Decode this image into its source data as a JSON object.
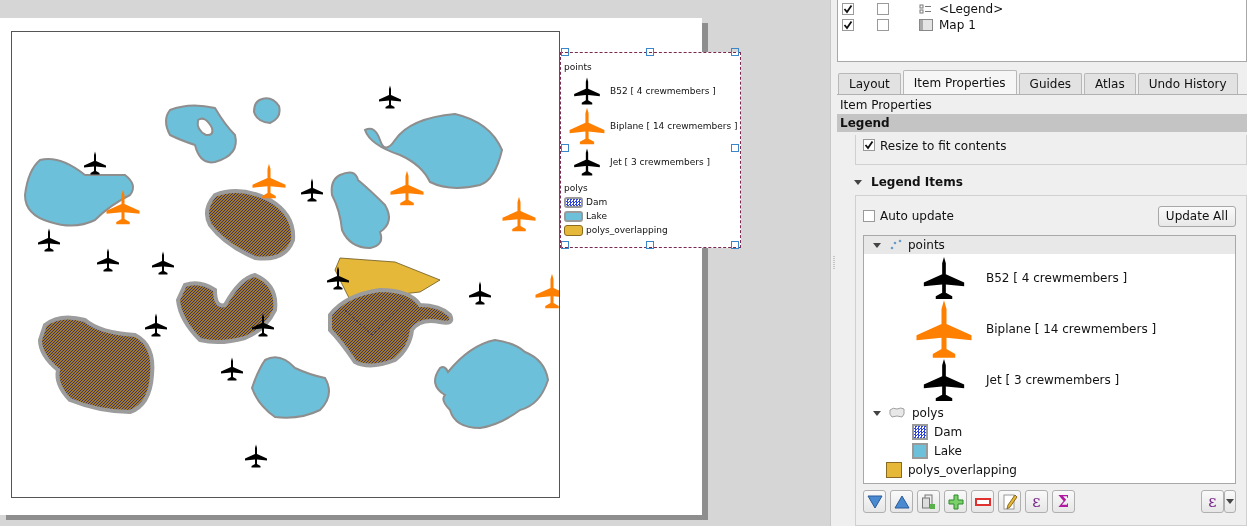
{
  "layout_items": [
    {
      "label": "<Legend>",
      "visible": true,
      "locked": false,
      "kind": "legend"
    },
    {
      "label": "Map 1",
      "visible": true,
      "locked": false,
      "kind": "map"
    }
  ],
  "tabs": [
    {
      "label": "Layout",
      "selected": false
    },
    {
      "label": "Item Properties",
      "selected": true
    },
    {
      "label": "Guides",
      "selected": false
    },
    {
      "label": "Atlas",
      "selected": false
    },
    {
      "label": "Undo History",
      "selected": false
    }
  ],
  "panel_title": "Item Properties",
  "section_title": "Legend",
  "resize_to_fit": {
    "label": "Resize to fit contents",
    "checked": true
  },
  "legend_items_title": "Legend Items",
  "legend_items_expanded": true,
  "auto_update": {
    "label": "Auto update",
    "checked": false
  },
  "update_all_button": "Update All",
  "legend_tree": [
    {
      "label": "points",
      "kind": "point-layer",
      "expanded": true,
      "selected": true,
      "children": [
        {
          "label": "B52 [ 4 crewmembers ]",
          "kind": "plane",
          "color": "#000000",
          "selected": false
        },
        {
          "label": "Biplane [ 14 crewmembers ]",
          "kind": "large-plane",
          "color": "#ff7f00",
          "selected": false
        },
        {
          "label": "Jet [ 3 crewmembers ]",
          "kind": "plane",
          "color": "#000000",
          "selected": false
        }
      ]
    },
    {
      "label": "polys",
      "kind": "polygon-layer",
      "expanded": true,
      "selected": false,
      "children": [
        {
          "label": "Dam",
          "kind": "hatch",
          "color": "#2f45e0",
          "selected": false
        },
        {
          "label": "Lake",
          "kind": "fill",
          "color": "#6dc0d9",
          "selected": false
        }
      ]
    },
    {
      "label": "polys_overlapping",
      "kind": "fill-layer",
      "color": "#e5b83a",
      "selected": false
    }
  ],
  "toolbar": [
    {
      "kind": "move-down"
    },
    {
      "kind": "move-up"
    },
    {
      "kind": "add-group"
    },
    {
      "kind": "add"
    },
    {
      "kind": "remove"
    },
    {
      "kind": "edit"
    },
    {
      "kind": "expression",
      "symbol": "ε"
    },
    {
      "kind": "count",
      "symbol": "Σ"
    }
  ],
  "filter_button": {
    "symbol": "ε"
  },
  "map_legend": [
    {
      "kind": "heading",
      "label": "points"
    },
    {
      "kind": "plane",
      "label": "B52 [ 4 crewmembers ]",
      "color": "#000000"
    },
    {
      "kind": "large-plane",
      "label": "Biplane [ 14 crewmembers ]",
      "color": "#ff7f00"
    },
    {
      "kind": "plane",
      "label": "Jet [ 3 crewmembers ]",
      "color": "#000000"
    },
    {
      "kind": "heading",
      "label": "polys"
    },
    {
      "kind": "hatch",
      "label": "Dam",
      "color": "#2f45e0"
    },
    {
      "kind": "fill",
      "label": "Lake",
      "color": "#6dc0d9"
    },
    {
      "kind": "fill-layer",
      "label": "polys_overlapping",
      "color": "#e5b83a"
    }
  ]
}
